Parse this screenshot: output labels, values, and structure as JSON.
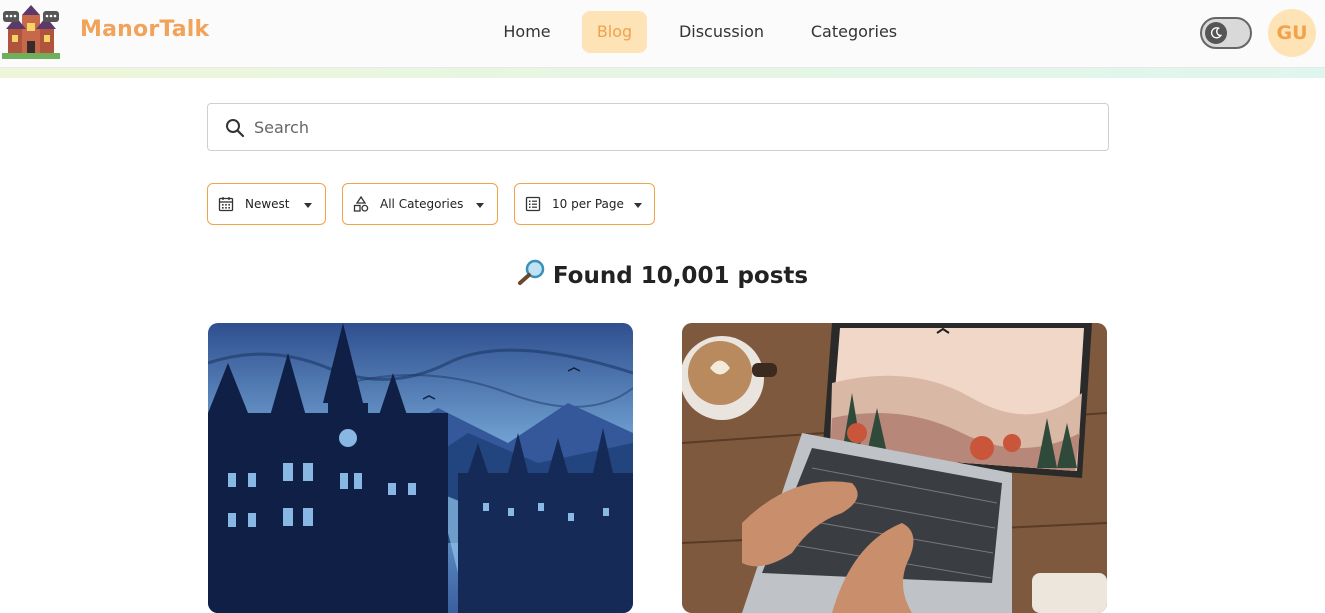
{
  "header": {
    "brand": "ManorTalk",
    "nav": [
      {
        "label": "Home",
        "active": false
      },
      {
        "label": "Blog",
        "active": true
      },
      {
        "label": "Discussion",
        "active": false
      },
      {
        "label": "Categories",
        "active": false
      }
    ],
    "theme_toggle_icon": "moon-icon",
    "avatar_initials": "GU"
  },
  "search": {
    "placeholder": "Search",
    "value": ""
  },
  "filters": {
    "sort": {
      "label": "Newest",
      "icon": "calendar-icon"
    },
    "category": {
      "label": "All Categories",
      "icon": "shapes-icon"
    },
    "per_page": {
      "label": "10 per Page",
      "icon": "list-icon"
    }
  },
  "results": {
    "icon": "magnifier-icon",
    "text": "Found 10,001 posts"
  },
  "posts": [
    {
      "image": "gothic-castle-town-illustration"
    },
    {
      "image": "laptop-typing-coffee-illustration"
    }
  ],
  "colors": {
    "accent": "#f0a24c",
    "accent_light": "#fde3b6"
  }
}
